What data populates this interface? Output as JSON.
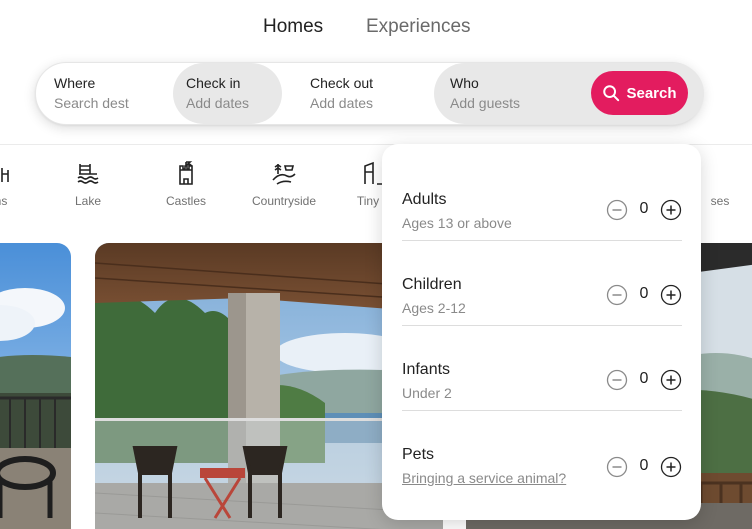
{
  "tabs": {
    "homes": "Homes",
    "experiences": "Experiences"
  },
  "search": {
    "where_label": "Where",
    "where_placeholder": "Search dest",
    "checkin_label": "Check in",
    "checkin_value": "Add dates",
    "checkout_label": "Check out",
    "checkout_value": "Add dates",
    "who_label": "Who",
    "who_value": "Add guests",
    "button_label": "Search",
    "accent": "#e31c5f"
  },
  "categories": [
    {
      "label": "ns",
      "icon": "room-icon"
    },
    {
      "label": "Lake",
      "icon": "lake-icon"
    },
    {
      "label": "Castles",
      "icon": "castle-icon"
    },
    {
      "label": "Countryside",
      "icon": "countryside-icon"
    },
    {
      "label": "Tiny H",
      "icon": "tiny-home-icon"
    },
    {
      "label": "ses",
      "icon": "category-icon"
    }
  ],
  "guests": [
    {
      "title": "Adults",
      "subtitle": "Ages 13 or above",
      "count": "0"
    },
    {
      "title": "Children",
      "subtitle": "Ages 2-12",
      "count": "0"
    },
    {
      "title": "Infants",
      "subtitle": "Under 2",
      "count": "0"
    },
    {
      "title": "Pets",
      "subtitle": "Bringing a service animal?",
      "count": "0"
    }
  ]
}
